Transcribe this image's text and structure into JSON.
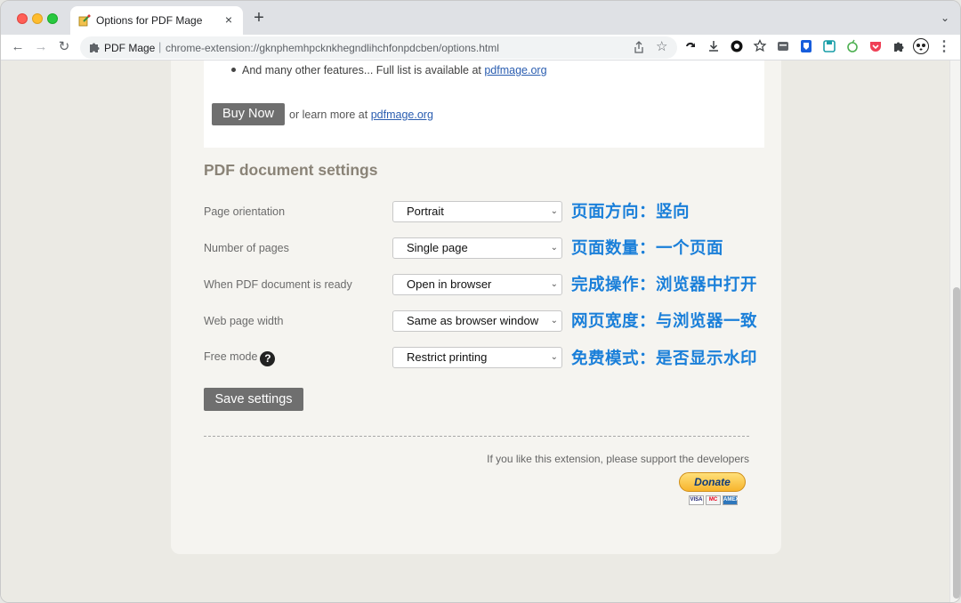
{
  "browser": {
    "tab_title": "Options for PDF Mage",
    "tab_close": "×",
    "new_tab": "+",
    "site_name": "PDF Mage",
    "url": "chrome-extension://gknphemhpcknkhegndlihchfonpdcben/options.html"
  },
  "promo": {
    "bullet_text": "And many other features... Full list is available at ",
    "bullet_link": "pdfmage.org",
    "buy_label": "Buy Now",
    "learn_text": "or learn more at ",
    "learn_link": "pdfmage.org"
  },
  "settings": {
    "title": "PDF document settings",
    "rows": [
      {
        "label": "Page orientation",
        "value": "Portrait",
        "annotation": "页面方向：竖向"
      },
      {
        "label": "Number of pages",
        "value": "Single page",
        "annotation": "页面数量：一个页面"
      },
      {
        "label": "When PDF document is ready",
        "value": "Open in browser",
        "annotation": "完成操作：浏览器中打开"
      },
      {
        "label": "Web page width",
        "value": "Same as browser window",
        "annotation": "网页宽度：与浏览器一致"
      },
      {
        "label": "Free mode",
        "value": "Restrict printing",
        "annotation": "免费模式：是否显示水印"
      }
    ],
    "help_glyph": "?",
    "save_label": "Save settings"
  },
  "support": {
    "text": "If you like this extension, please support the developers",
    "donate_label": "Donate",
    "cards": [
      "VISA",
      "MC",
      "AMEX"
    ]
  },
  "colors": {
    "accent_annotation": "#1a7fd9",
    "button_gray": "#6f6f6f",
    "link": "#2a5db0"
  }
}
